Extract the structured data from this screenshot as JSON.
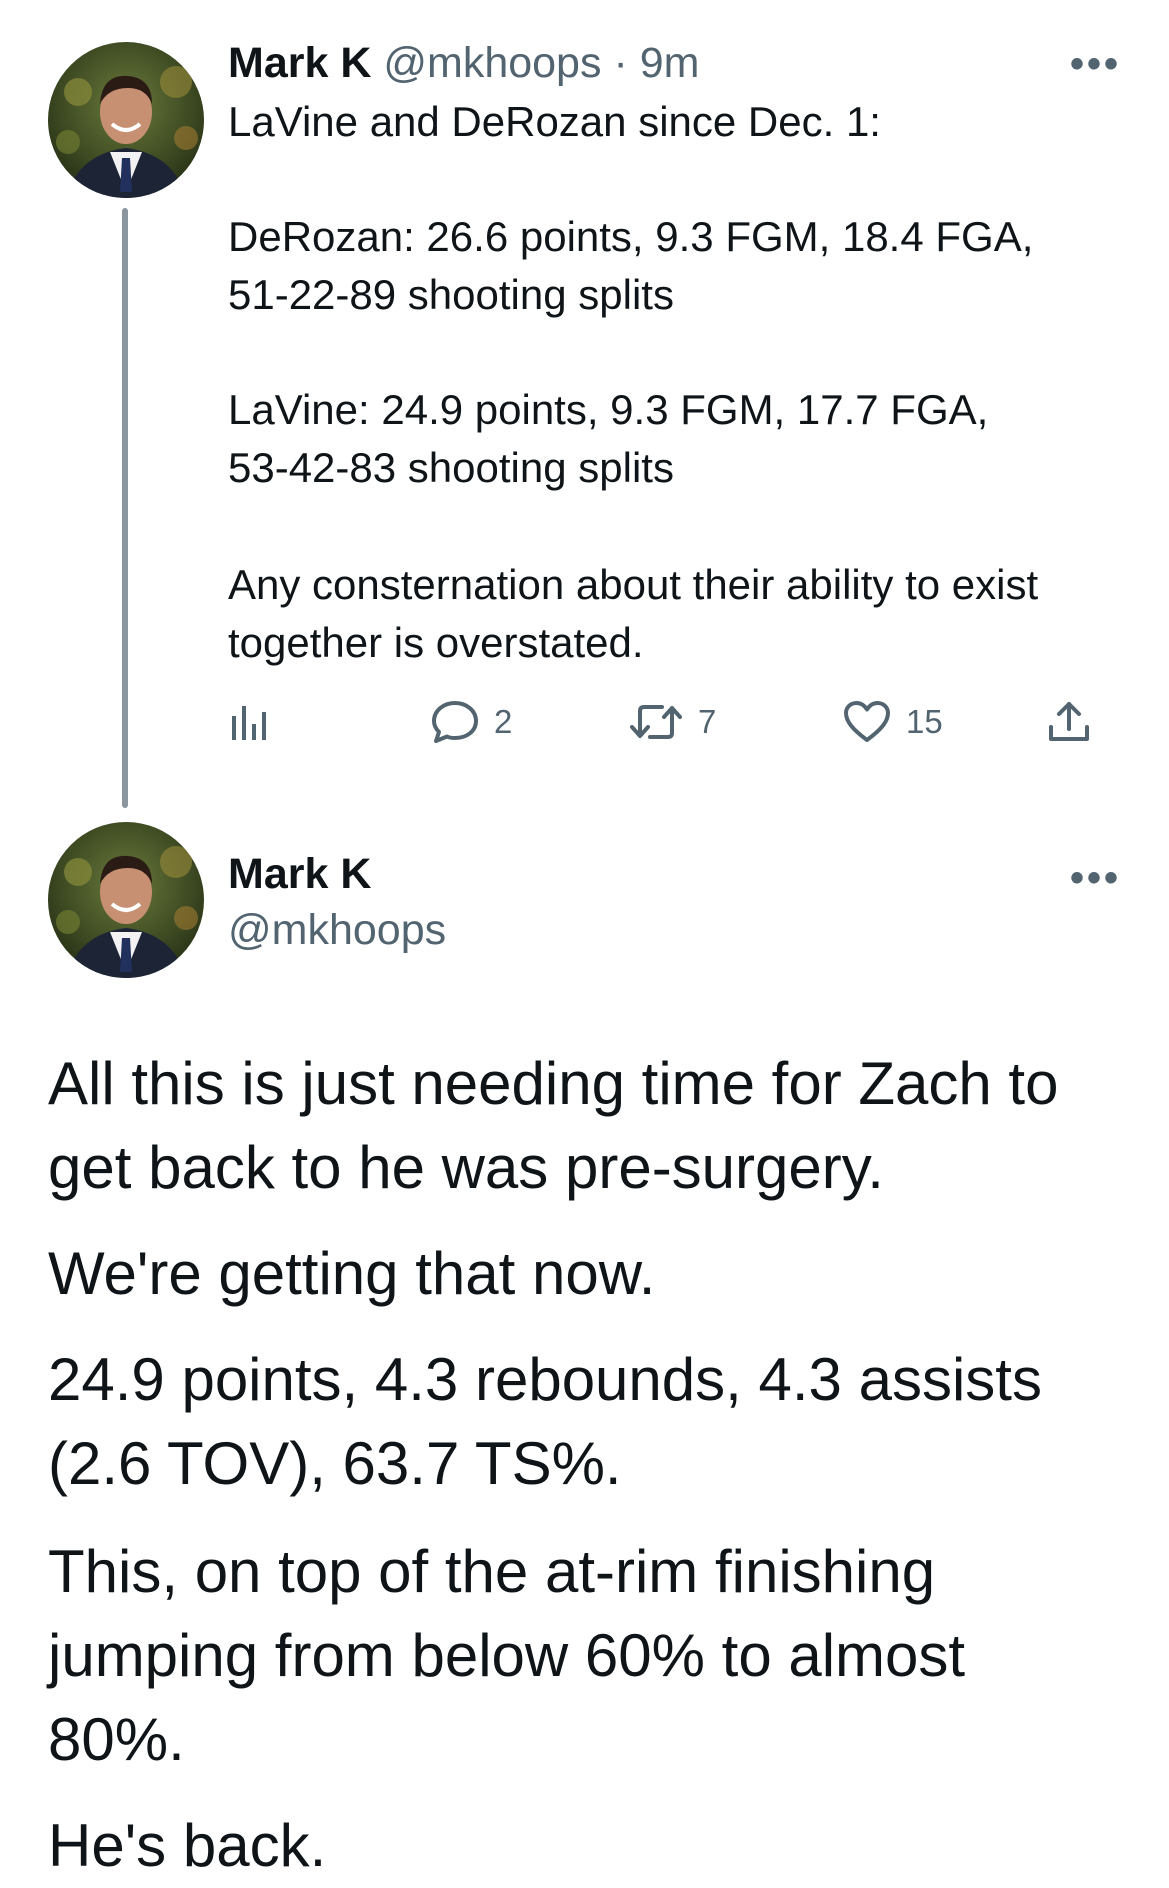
{
  "tweet1": {
    "author_name": "Mark K",
    "handle": "@mkhoops",
    "separator": "·",
    "time": "9m",
    "more_icon": "more-horizontal-icon",
    "lines": [
      "LaVine and DeRozan since Dec. 1:",
      "DeRozan: 26.6 points, 9.3 FGM, 18.4 FGA,",
      "51-22-89 shooting splits",
      "LaVine: 24.9 points, 9.3 FGM, 17.7 FGA,",
      "53-42-83 shooting splits",
      "Any consternation about their ability to exist",
      "together is overstated."
    ],
    "actions": {
      "analytics_icon": "analytics-icon",
      "replies": "2",
      "retweets": "7",
      "likes": "15",
      "share_icon": "share-icon"
    }
  },
  "tweet2": {
    "author_name": "Mark K",
    "handle": "@mkhoops",
    "more_icon": "more-horizontal-icon",
    "lines": [
      "All this is just needing time for Zach to",
      "get back to he was pre-surgery.",
      "We're getting that now.",
      "24.9 points, 4.3 rebounds, 4.3 assists",
      "(2.6 TOV), 63.7 TS%.",
      "This, on top of the at-rim finishing",
      "jumping from below 60% to almost",
      "80%.",
      "He's back."
    ]
  },
  "colors": {
    "text": "#0f1419",
    "muted": "#536471",
    "thread_line": "#8a959e",
    "background": "#ffffff"
  }
}
